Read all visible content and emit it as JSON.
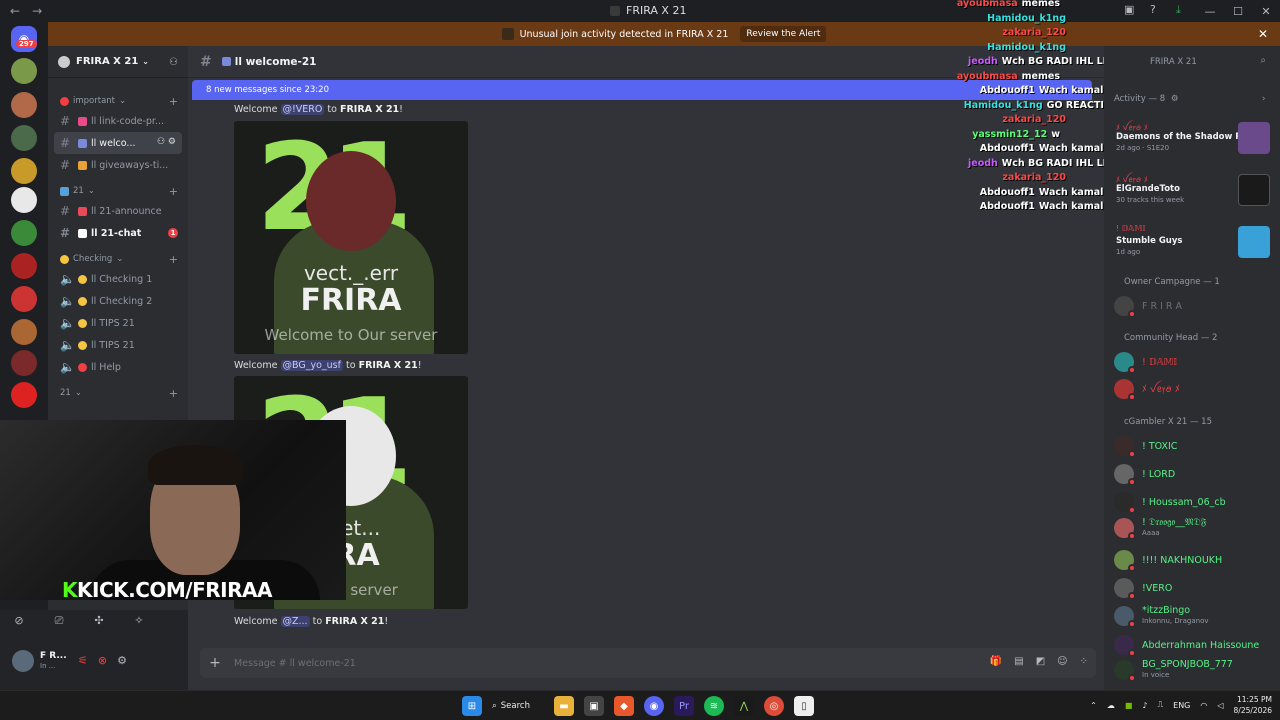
{
  "window": {
    "title": "FRIRA X 21"
  },
  "banner": {
    "text": "Unusual join activity detected in FRIRA X 21",
    "action": "Review the Alert"
  },
  "rail": {
    "badge": "297"
  },
  "sidebar": {
    "server_name": "FRIRA X 21",
    "categories": [
      {
        "label": "important"
      },
      {
        "label": "21"
      },
      {
        "label": "Checking"
      },
      {
        "label": "21"
      }
    ],
    "channels": [
      {
        "label": "ll link-code-pr..."
      },
      {
        "label": "ll welco..."
      },
      {
        "label": "ll giveaways-ti..."
      },
      {
        "label": "ll 21-announce"
      },
      {
        "label": "ll 21-chat",
        "badge": "1"
      },
      {
        "label": "ll Checking 1"
      },
      {
        "label": "ll Checking 2"
      },
      {
        "label": "ll TIPS 21"
      },
      {
        "label": "ll TIPS 21"
      },
      {
        "label": "ll Help"
      }
    ]
  },
  "userpanel": {
    "name": "F R...",
    "status": "In ..."
  },
  "chat": {
    "channel": "ll welcome-21",
    "new_messages": "8 new messages since 23:20",
    "messages": [
      {
        "prefix": "Welcome",
        "mention": "@!VERO",
        "mid": "to",
        "server": "FRIRA X 21",
        "end": "!"
      },
      {
        "prefix": "Welcome",
        "mention": "@BG_yo_usf",
        "mid": "to",
        "server": "FRIRA X 21",
        "end": "!"
      },
      {
        "prefix": "Welcome",
        "mention": "@Z...",
        "mid": "to",
        "server": "FRIRA X 21",
        "end": "!"
      }
    ],
    "images": [
      {
        "name_text": "vect._.err",
        "brand": "FRIRA",
        "welcome": "Welcome to Our server"
      },
      {
        "name_text": "met...",
        "brand": "IRA",
        "welcome": "o Our server"
      }
    ],
    "composer_placeholder": "Message # ll welcome-21"
  },
  "overlay": {
    "lines": [
      {
        "user": "ayoubmasa",
        "text": "memes",
        "color": "#ff4a4a"
      },
      {
        "user": "Hamidou_k1ng",
        "text": "",
        "color": "#34e3e3"
      },
      {
        "user": "zakaria_120",
        "text": "",
        "color": "#ff4a4a"
      },
      {
        "user": "Hamidou_k1ng",
        "text": "",
        "color": "#34e3e3"
      },
      {
        "user": "jeodh",
        "text": "Wch BG RADI IHL LIVE",
        "color": "#c85cff"
      },
      {
        "user": "ayoubmasa",
        "text": "memes",
        "color": "#ff4a4a"
      },
      {
        "user": "Abdouoff1",
        "text": "Wach kamal on",
        "color": "#ffffff"
      },
      {
        "user": "Hamidou_k1ng",
        "text": "GO REACTION",
        "color": "#34e3e3"
      },
      {
        "user": "zakaria_120",
        "text": "",
        "color": "#ff4a4a"
      },
      {
        "user": "yassmin12_12",
        "text": "w",
        "color": "#5cff7a"
      },
      {
        "user": "Abdouoff1",
        "text": "Wach kamal on",
        "color": "#ffffff"
      },
      {
        "user": "jeodh",
        "text": "Wch BG RADI IHL LIVE",
        "color": "#c85cff"
      },
      {
        "user": "zakaria_120",
        "text": "",
        "color": "#ff4a4a"
      },
      {
        "user": "Abdouoff1",
        "text": "Wach kamal on",
        "color": "#ffffff"
      },
      {
        "user": "Abdouoff1",
        "text": "Wach kamal on",
        "color": "#ffffff"
      }
    ]
  },
  "members": {
    "search": "FRIRA X 21",
    "activity_header": "Activity — 8",
    "activities": [
      {
        "title": "ﾒ ꪜꫀ᥅ꪮ ﾒ",
        "game": "Daemons of the Shadow R...",
        "sub": "2d ago · S1E20"
      },
      {
        "title": "ﾒ ꪜꫀ᥅ꪮ ﾒ",
        "game": "ElGrandeToto",
        "sub": "30 tracks this week"
      },
      {
        "title": "! 𝔻𝔸𝕄𝕀",
        "game": "Stumble Guys",
        "sub": "1d ago"
      }
    ],
    "groups": [
      {
        "label": "Owner Campagne — 1"
      },
      {
        "label": "Community Head — 2"
      },
      {
        "label": "cGambler X 21 — 15"
      }
    ],
    "list": [
      {
        "name": "F R I R A",
        "sub": "",
        "color": "#6d6f78"
      },
      {
        "name": "! 𝔻𝔸𝕄𝕀",
        "sub": "",
        "color": "#f23f43"
      },
      {
        "name": "ﾒ ꪜꫀ᥅ꪮ ﾒ",
        "sub": "",
        "color": "#f23f43"
      },
      {
        "name": "! TOXIC",
        "sub": "",
        "color": "#57f287"
      },
      {
        "name": "! LORD",
        "sub": "",
        "color": "#57f287"
      },
      {
        "name": "! Houssam_06_cb",
        "sub": "",
        "color": "#57f287"
      },
      {
        "name": "! 𝔇𝔯𝔬𝔬𝔤𝔬__𝔐𝔇𝔉",
        "sub": "Aaaa",
        "color": "#57f287"
      },
      {
        "name": "!!!! NAKHNOUKH",
        "sub": "",
        "color": "#57f287"
      },
      {
        "name": "!VERO",
        "sub": "",
        "color": "#57f287"
      },
      {
        "name": "*itzzBingo",
        "sub": "Inkonnu, Draganov",
        "color": "#57f287"
      },
      {
        "name": "Abderrahman Haissoune",
        "sub": "",
        "color": "#57f287"
      },
      {
        "name": "BG_SPONJBOB_777",
        "sub": "In voice",
        "color": "#57f287"
      }
    ]
  },
  "cam": {
    "kick_text": "KICK.COM/FRIRAA"
  },
  "taskbar": {
    "search": "Search",
    "lang": "ENG",
    "time": "11:25 PM",
    "date": "8/25/2026"
  }
}
